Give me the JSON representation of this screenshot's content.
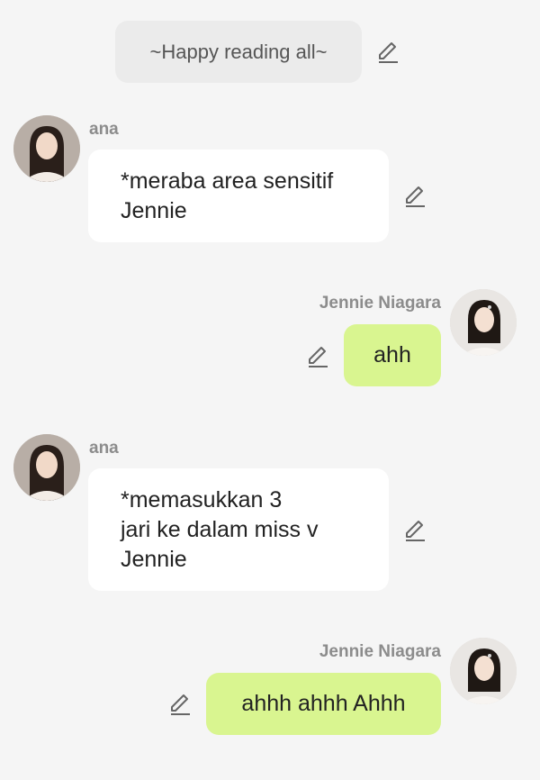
{
  "system_message": {
    "text": "~Happy reading all~"
  },
  "messages": [
    {
      "sender": "ana",
      "lines": [
        "*meraba area sensitif",
        "Jennie"
      ]
    },
    {
      "sender": "Jennie Niagara",
      "lines": [
        "ahh"
      ]
    },
    {
      "sender": "ana",
      "lines": [
        "*memasukkan 3",
        "jari ke dalam miss v",
        "Jennie"
      ]
    },
    {
      "sender": "Jennie Niagara",
      "lines": [
        "ahhh ahhh Ahhh"
      ]
    }
  ],
  "colors": {
    "background": "#f5f5f5",
    "incoming_bubble": "#ffffff",
    "outgoing_bubble": "#d9f590",
    "system_bubble": "#ebebeb",
    "sender_name": "#8c8c8c"
  },
  "icons": {
    "edit": "pencil-icon",
    "avatar_ana": "avatar",
    "avatar_jennie": "avatar"
  }
}
